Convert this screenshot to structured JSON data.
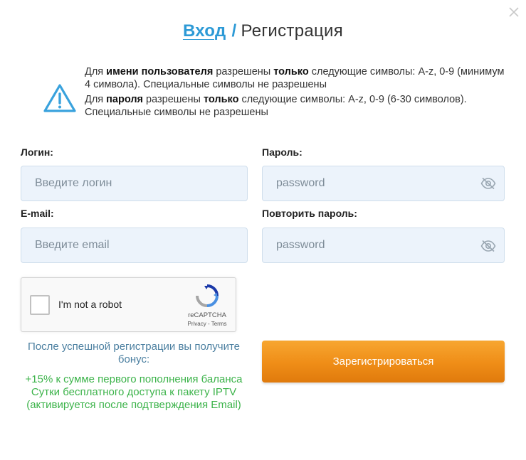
{
  "header": {
    "login_link": "Вход",
    "separator": "/",
    "register_title": "Регистрация"
  },
  "rules": {
    "username": {
      "p1": "Для ",
      "b1": "имени пользователя",
      "p2": " разрешены ",
      "b2": "только",
      "p3": " следующие символы: A-z, 0-9 (минимум 4 символа). Специальные символы не разрешены"
    },
    "password": {
      "p1": "Для ",
      "b1": "пароля",
      "p2": " разрешены ",
      "b2": "только",
      "p3": " следующие символы: A-z, 0-9 (6-30 символов). Специальные символы не разрешены"
    }
  },
  "form": {
    "login_label": "Логин:",
    "login_placeholder": "Введите логин",
    "password_label": "Пароль:",
    "password_placeholder": "password",
    "email_label": "E-mail:",
    "email_placeholder": "Введите email",
    "repeat_password_label": "Повторить пароль:",
    "repeat_password_placeholder": "password"
  },
  "captcha": {
    "label": "I'm not a robot",
    "brand": "reCAPTCHA",
    "links": "Privacy - Terms"
  },
  "bonus": {
    "heading": "После успешной регистрации вы получите бонус:",
    "line1": "+15% к сумме первого пополнения баланса",
    "line2": "Сутки бесплатного доступа к пакету IPTV (активируется после подтверждения Email)"
  },
  "submit_label": "Зарегистрироваться",
  "colors": {
    "accent_blue": "#2d9ad6",
    "bonus_green": "#3cb34a",
    "button_orange": "#ef8d17",
    "input_bg": "#ecf3fb"
  }
}
